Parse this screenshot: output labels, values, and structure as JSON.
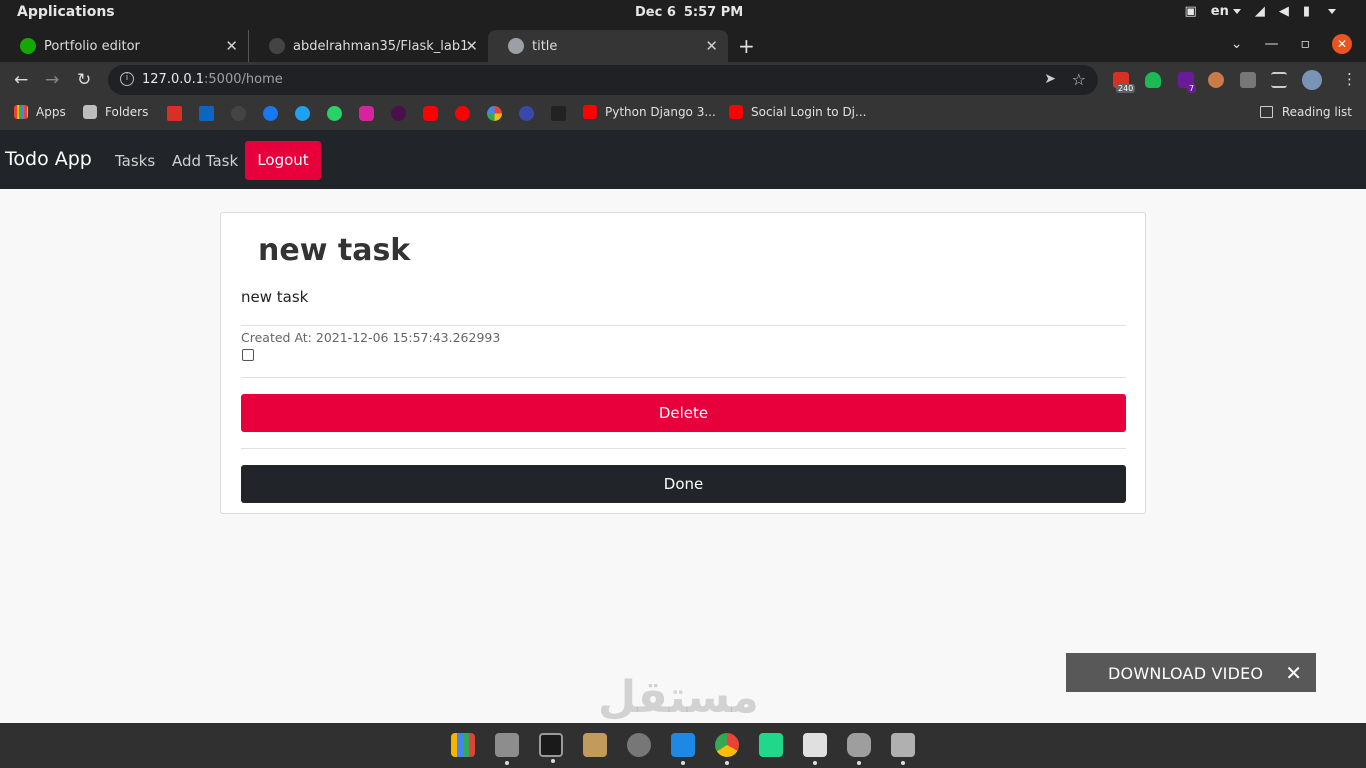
{
  "os": {
    "apps_label": "Applications",
    "date": "Dec 6",
    "time": "5:57 PM",
    "lang": "en"
  },
  "tabs": [
    {
      "title": "Portfolio editor",
      "color": "#14a800"
    },
    {
      "title": "abdelrahman35/Flask_lab1",
      "color": "#444444"
    },
    {
      "title": "title",
      "color": "#9aa0a6"
    }
  ],
  "address": {
    "host": "127.0.0.1",
    "path": ":5000/home"
  },
  "extensions": {
    "gmail_badge": "240",
    "ext_badge": "7"
  },
  "bookmarks": {
    "apps": "Apps",
    "folders": "Folders",
    "python_django": "Python Django 3...",
    "social_login": "Social Login to Dj...",
    "reading_list": "Reading list"
  },
  "navbar": {
    "brand": "Todo App",
    "tasks": "Tasks",
    "add_task": "Add Task",
    "logout": "Logout"
  },
  "task": {
    "title": "new task",
    "description": "new task",
    "created_at": "Created At: 2021-12-06 15:57:43.262993",
    "done": false,
    "delete_label": "Delete",
    "done_label": "Done"
  },
  "overlay": {
    "download_video": "DOWNLOAD VIDEO"
  },
  "colors": {
    "accent": "#e8003c",
    "navbar": "#212529"
  }
}
